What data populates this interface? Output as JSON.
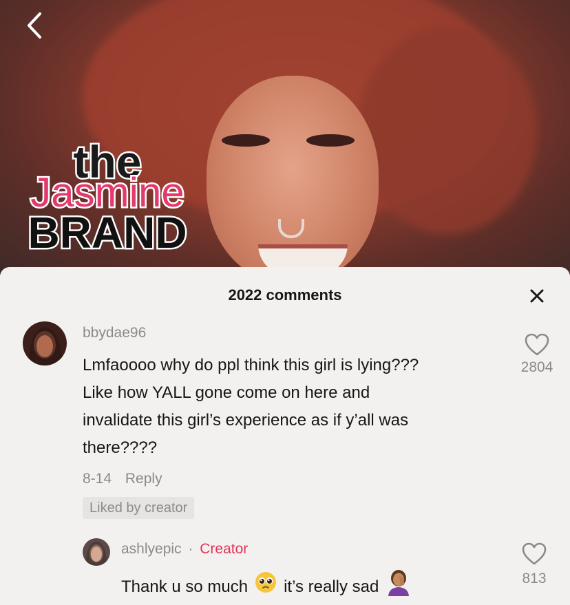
{
  "video": {
    "watermark": {
      "line1": "the",
      "line2": "Jasmine",
      "line3": "BRAND"
    }
  },
  "comments_panel": {
    "title": "2022 comments"
  },
  "comments": [
    {
      "username": "bbydae96",
      "text_lines": [
        "Lmfaoooo why do ppl think this girl is lying???",
        "Like how YALL gone come on here and",
        "invalidate this girl’s experience as if y’all was",
        "there????"
      ],
      "date": "8-14",
      "reply_label": "Reply",
      "badge": "Liked by creator",
      "like_count": "2804"
    }
  ],
  "reply": {
    "username": "ashlyepic",
    "separator": "·",
    "role": "Creator",
    "text_start": "Thank u so much",
    "text_end": "it’s really sad",
    "like_count": "813"
  },
  "colors": {
    "accent": "#e3345a",
    "panel_bg": "#f2f1f0",
    "muted_text": "#8a8a8a"
  },
  "icons": {
    "back": "back-chevron-icon",
    "close": "close-icon",
    "like": "heart-outline-icon",
    "emoji_pleading": "pleading-face-emoji-icon",
    "emoji_facepalm": "facepalm-emoji-icon"
  }
}
